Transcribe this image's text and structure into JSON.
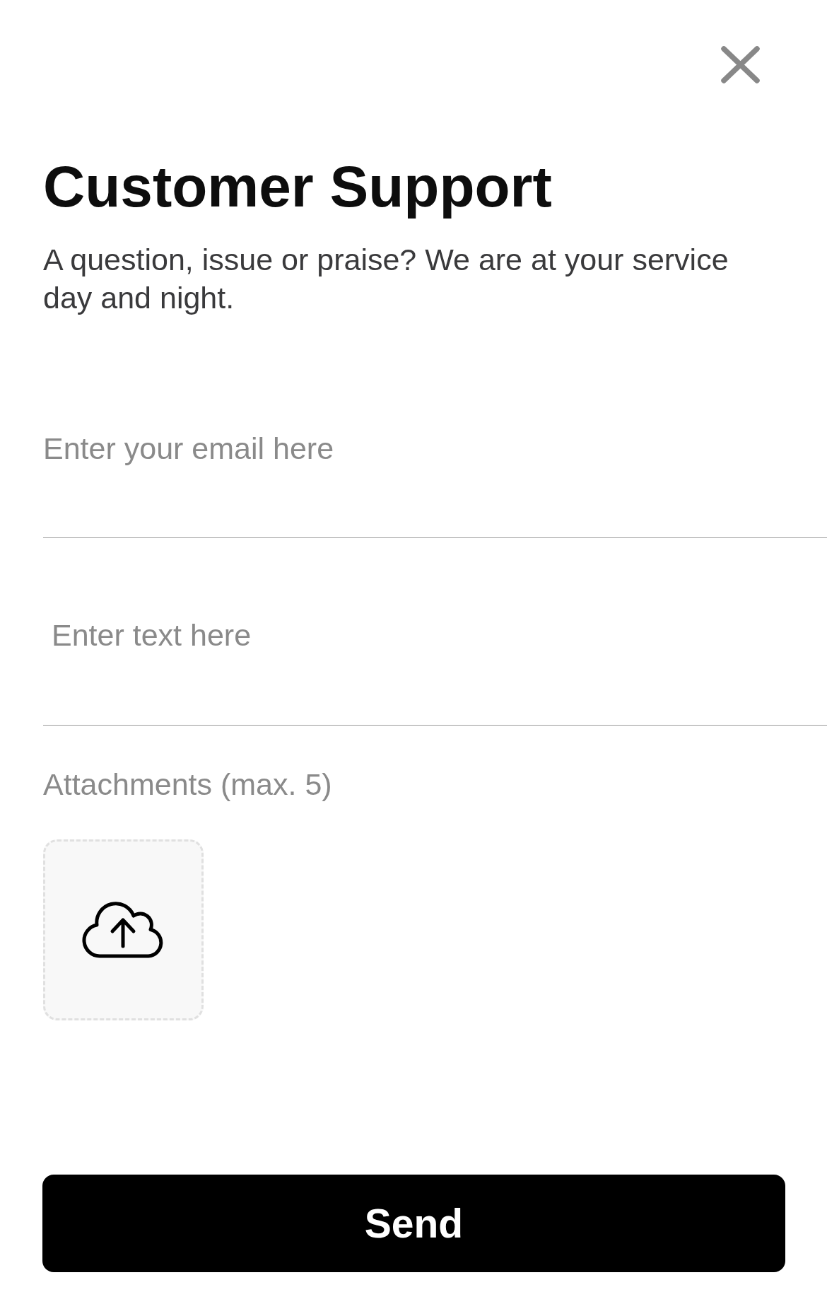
{
  "title": "Customer Support",
  "subtitle": "A question, issue or praise? We are at your service day and night.",
  "form": {
    "fields": [
      {
        "kind": "email",
        "placeholder": "Enter your email here"
      },
      {
        "kind": "text",
        "placeholder": "Enter text here"
      }
    ],
    "attachments": {
      "label": "Attachments (max. 5)"
    }
  },
  "send_button": {
    "label": "Send"
  }
}
